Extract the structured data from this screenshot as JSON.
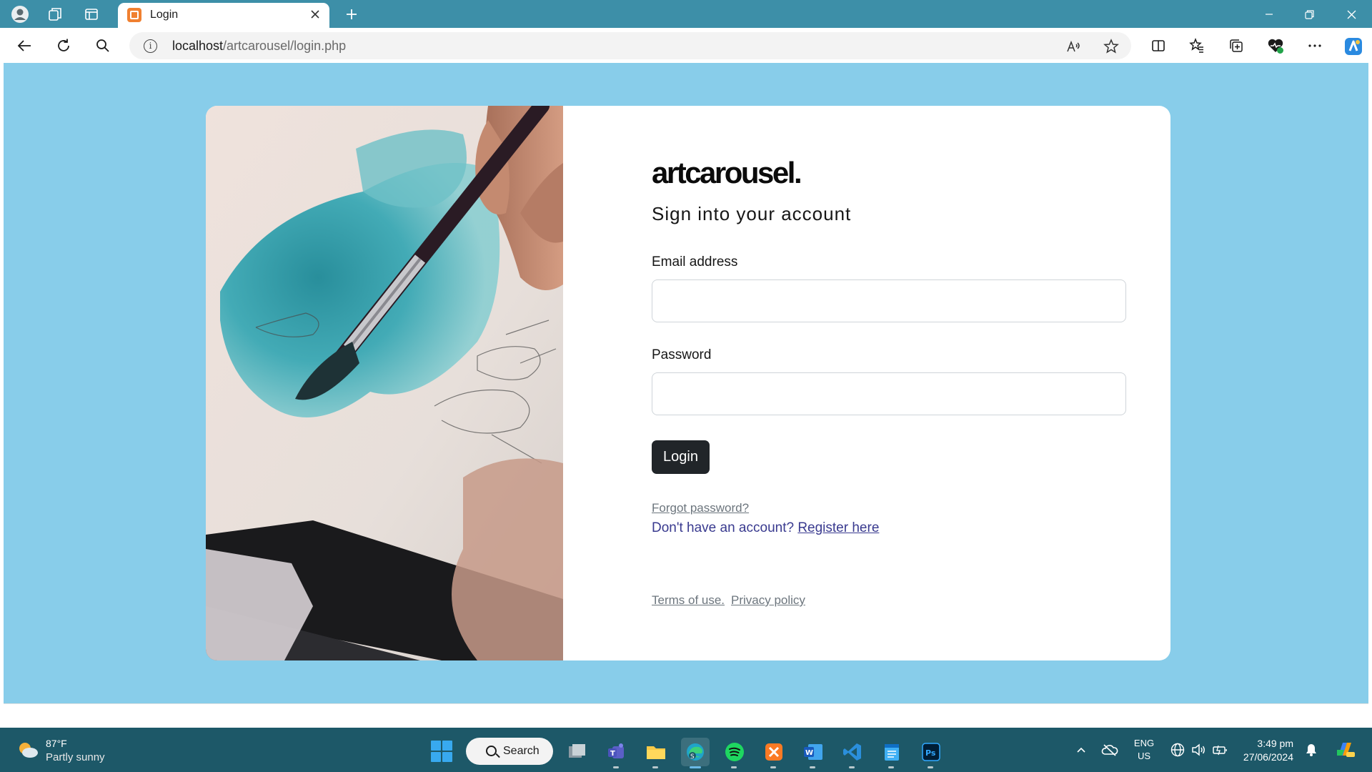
{
  "browser": {
    "tab_title": "Login",
    "url_host": "localhost",
    "url_path": "/artcarousel/login.php"
  },
  "page": {
    "logo_text": "artcarousel.",
    "heading": "Sign into your account",
    "email_label": "Email address",
    "email_value": "",
    "password_label": "Password",
    "password_value": "",
    "login_button": "Login",
    "forgot_link": "Forgot password?",
    "no_account_text": "Don't have an account? ",
    "register_link": "Register here",
    "terms_link": "Terms of use.",
    "privacy_link": "Privacy policy",
    "background_color": "#88cdea"
  },
  "taskbar": {
    "weather_temp": "87°F",
    "weather_desc": "Partly sunny",
    "search_label": "Search",
    "lang_line1": "ENG",
    "lang_line2": "US",
    "time": "3:49 pm",
    "date": "27/06/2024",
    "apps": [
      "file-explorer-icon",
      "teams-icon",
      "folder-icon",
      "edge-icon",
      "spotify-icon",
      "xampp-icon",
      "word-icon",
      "vscode-icon",
      "notepad-icon",
      "photoshop-icon"
    ]
  }
}
